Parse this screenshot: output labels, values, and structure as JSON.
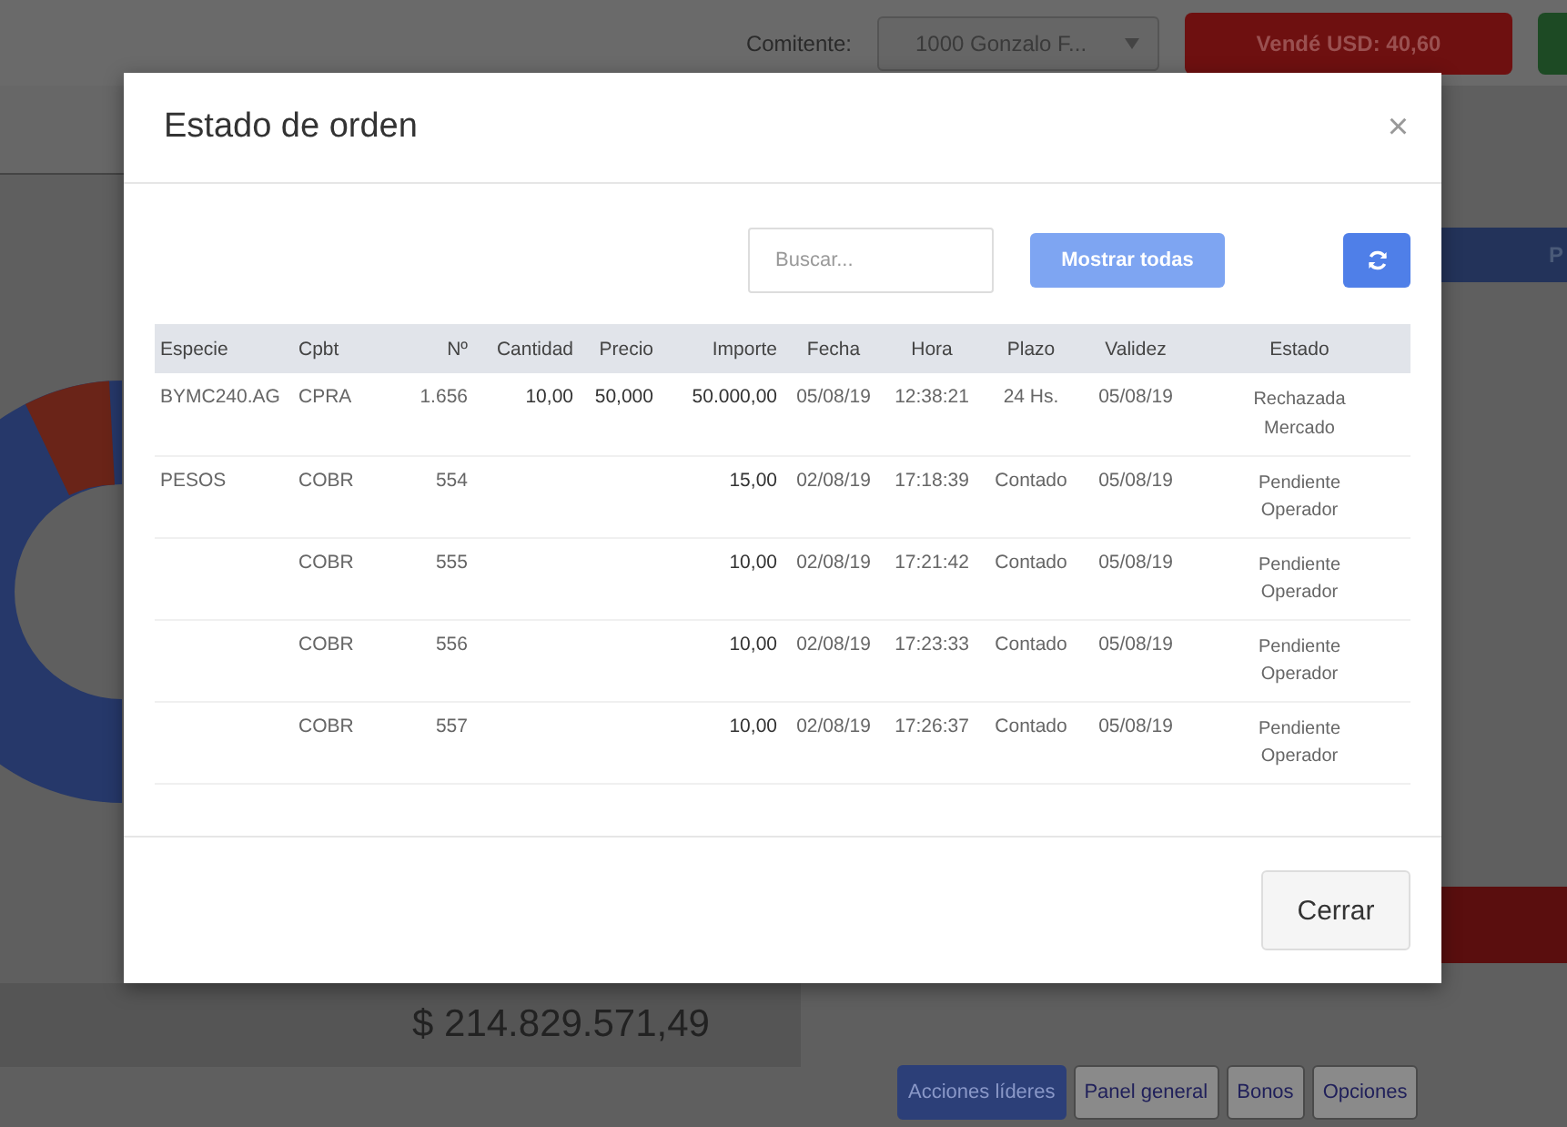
{
  "top_bar": {
    "client_label": "Comitente:",
    "client_select": "1000 Gonzalo F...",
    "sell_button": "Vendé USD: 40,60"
  },
  "right_panel": {
    "header": "P"
  },
  "total": "$ 214.829.571,49",
  "bottom_tabs": [
    {
      "label": "Acciones líderes",
      "selected": true
    },
    {
      "label": "Panel general",
      "selected": false
    },
    {
      "label": "Bonos",
      "selected": false
    },
    {
      "label": "Opciones",
      "selected": false
    }
  ],
  "dialog": {
    "title": "Estado de orden",
    "search": {
      "placeholder": "Buscar..."
    },
    "show_all_button": "Mostrar todas",
    "close_icon": "×",
    "table": {
      "columns": [
        "Especie",
        "Cpbt",
        "Nº",
        "Cantidad",
        "Precio",
        "Importe",
        "Fecha",
        "Hora",
        "Plazo",
        "Validez",
        "Estado"
      ],
      "rows": [
        {
          "especie": "BYMC240.AG",
          "cpbt": "CPRA",
          "numero": "1.656",
          "cantidad": "10,00",
          "precio": "50,000",
          "importe": "50.000,00",
          "fecha": "05/08/19",
          "hora": "12:38:21",
          "plazo": "24 Hs.",
          "validez": "05/08/19",
          "estado": "Rechazada Mercado"
        },
        {
          "especie": "PESOS",
          "cpbt": "COBR",
          "numero": "554",
          "importe": "15,00",
          "fecha": "02/08/19",
          "hora": "17:18:39",
          "plazo": "Contado",
          "validez": "05/08/19",
          "estado": "Pendiente Operador"
        },
        {
          "cpbt": "COBR",
          "numero": "555",
          "importe": "10,00",
          "fecha": "02/08/19",
          "hora": "17:21:42",
          "plazo": "Contado",
          "validez": "05/08/19",
          "estado": "Pendiente Operador"
        },
        {
          "cpbt": "COBR",
          "numero": "556",
          "importe": "10,00",
          "fecha": "02/08/19",
          "hora": "17:23:33",
          "plazo": "Contado",
          "validez": "05/08/19",
          "estado": "Pendiente Operador"
        },
        {
          "cpbt": "COBR",
          "numero": "557",
          "importe": "10,00",
          "fecha": "02/08/19",
          "hora": "17:26:37",
          "plazo": "Contado",
          "validez": "05/08/19",
          "estado": "Pendiente Operador"
        }
      ]
    },
    "close_button": "Cerrar"
  }
}
